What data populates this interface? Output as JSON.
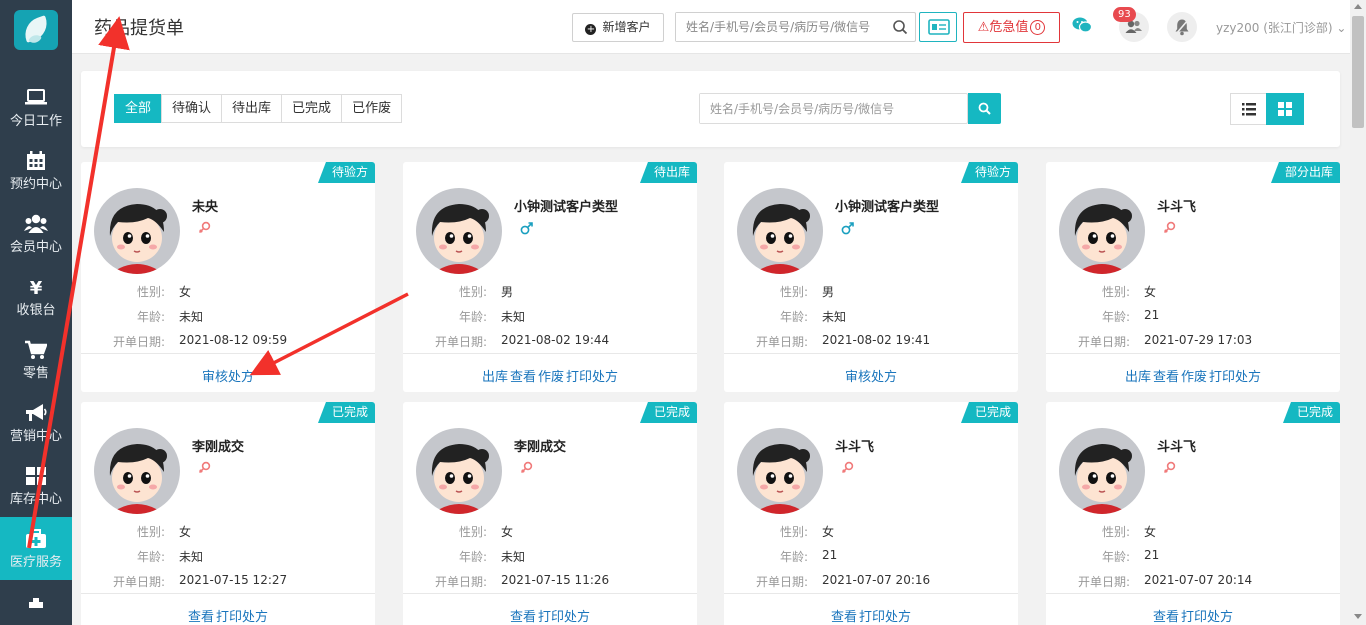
{
  "sidebar": {
    "items": [
      {
        "label": "今日工作",
        "icon": "laptop-icon"
      },
      {
        "label": "预约中心",
        "icon": "calendar-icon"
      },
      {
        "label": "会员中心",
        "icon": "users-icon"
      },
      {
        "label": "收银台",
        "icon": "yen-icon"
      },
      {
        "label": "零售",
        "icon": "cart-icon"
      },
      {
        "label": "营销中心",
        "icon": "megaphone-icon"
      },
      {
        "label": "库存中心",
        "icon": "grid-icon"
      },
      {
        "label": "医疗服务",
        "icon": "medkit-icon",
        "active": true
      }
    ]
  },
  "header": {
    "title": "药品提货单",
    "add_customer": "新增客户",
    "search_placeholder": "姓名/手机号/会员号/病历号/微信号",
    "critical_label": "危急值",
    "critical_count": "0",
    "notification_count": "93",
    "user": "yzy200 (张江门诊部)"
  },
  "filter": {
    "tabs": [
      "全部",
      "待确认",
      "待出库",
      "已完成",
      "已作废"
    ],
    "active_tab": "全部",
    "search_placeholder": "姓名/手机号/会员号/病历号/微信号"
  },
  "labels": {
    "gender": "性别:",
    "age": "年龄:",
    "date": "开单日期:"
  },
  "cards": [
    {
      "status": "待验方",
      "name": "未央",
      "gender": "女",
      "age": "未知",
      "date": "2021-08-12 09:59",
      "actions": [
        "审核处方"
      ]
    },
    {
      "status": "待出库",
      "name": "小钟测试客户类型",
      "gender": "男",
      "age": "未知",
      "date": "2021-08-02 19:44",
      "actions": [
        "出库",
        "查看",
        "作废",
        "打印处方"
      ]
    },
    {
      "status": "待验方",
      "name": "小钟测试客户类型",
      "gender": "男",
      "age": "未知",
      "date": "2021-08-02 19:41",
      "actions": [
        "审核处方"
      ]
    },
    {
      "status": "部分出库",
      "name": "斗斗飞",
      "gender": "女",
      "age": "21",
      "date": "2021-07-29 17:03",
      "actions": [
        "出库",
        "查看",
        "作废",
        "打印处方"
      ]
    },
    {
      "status": "已完成",
      "name": "李刚成交",
      "gender": "女",
      "age": "未知",
      "date": "2021-07-15 12:27",
      "actions": [
        "查看",
        "打印处方"
      ]
    },
    {
      "status": "已完成",
      "name": "李刚成交",
      "gender": "女",
      "age": "未知",
      "date": "2021-07-15 11:26",
      "actions": [
        "查看",
        "打印处方"
      ]
    },
    {
      "status": "已完成",
      "name": "斗斗飞",
      "gender": "女",
      "age": "21",
      "date": "2021-07-07 20:16",
      "actions": [
        "查看",
        "打印处方"
      ]
    },
    {
      "status": "已完成",
      "name": "斗斗飞",
      "gender": "女",
      "age": "21",
      "date": "2021-07-07 20:14",
      "actions": [
        "查看",
        "打印处方"
      ]
    }
  ],
  "colors": {
    "accent": "#15b8c2",
    "sidebar": "#2f3e4c",
    "link": "#1a75bc",
    "danger": "#e1363a",
    "female": "#f07a7a",
    "male": "#1a9fbf",
    "annotation": "#f2312b"
  }
}
